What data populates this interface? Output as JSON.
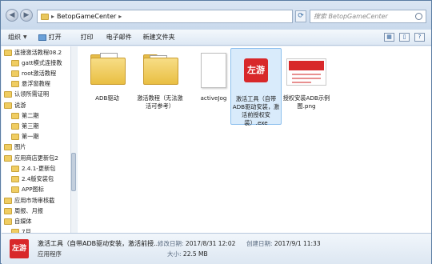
{
  "address": {
    "path": "BetopGameCenter",
    "search_placeholder": "搜索 BetopGameCenter"
  },
  "toolbar": {
    "organize": "组织",
    "open": "打开",
    "print": "打印",
    "email": "电子邮件",
    "new_folder": "新建文件夹"
  },
  "sidebar": {
    "items": [
      {
        "label": "连接激活教程08.2"
      },
      {
        "label": "gatt模式连接教"
      },
      {
        "label": "root激活教程"
      },
      {
        "label": "悬浮窗教程"
      },
      {
        "label": "认领所需证明"
      },
      {
        "label": "说游"
      },
      {
        "label": "第二期"
      },
      {
        "label": "第三期"
      },
      {
        "label": "第一期"
      },
      {
        "label": "图片"
      },
      {
        "label": "应用商店更新包2"
      },
      {
        "label": "2.4.1-更新包"
      },
      {
        "label": "2.4版安装包"
      },
      {
        "label": "APP图标"
      },
      {
        "label": "应用市场审核截"
      },
      {
        "label": "周报、月报"
      },
      {
        "label": "自媒体"
      },
      {
        "label": "7月"
      }
    ]
  },
  "files": [
    {
      "name": "ADB驱动",
      "type": "folder"
    },
    {
      "name": "激活教程（无法激活可参考）",
      "type": "folder"
    },
    {
      "name": "activeJog",
      "type": "file"
    },
    {
      "name": "激活工具（自带ADB驱动安装，激活前授权安装）.exe",
      "type": "exe",
      "badge": "左游"
    },
    {
      "name": "授权安装ADB示例图.png",
      "type": "png"
    }
  ],
  "details": {
    "badge": "左游",
    "name": "激活工具（自带ADB驱动安装，激活前授...",
    "type": "应用程序",
    "modified_label": "修改日期:",
    "modified": "2017/8/31 12:02",
    "created_label": "创建日期:",
    "created": "2017/9/1 11:33",
    "size_label": "大小:",
    "size": "22.5 MB"
  },
  "colors": {
    "brand_red": "#d8282a",
    "selection": "#d9ebfb"
  }
}
